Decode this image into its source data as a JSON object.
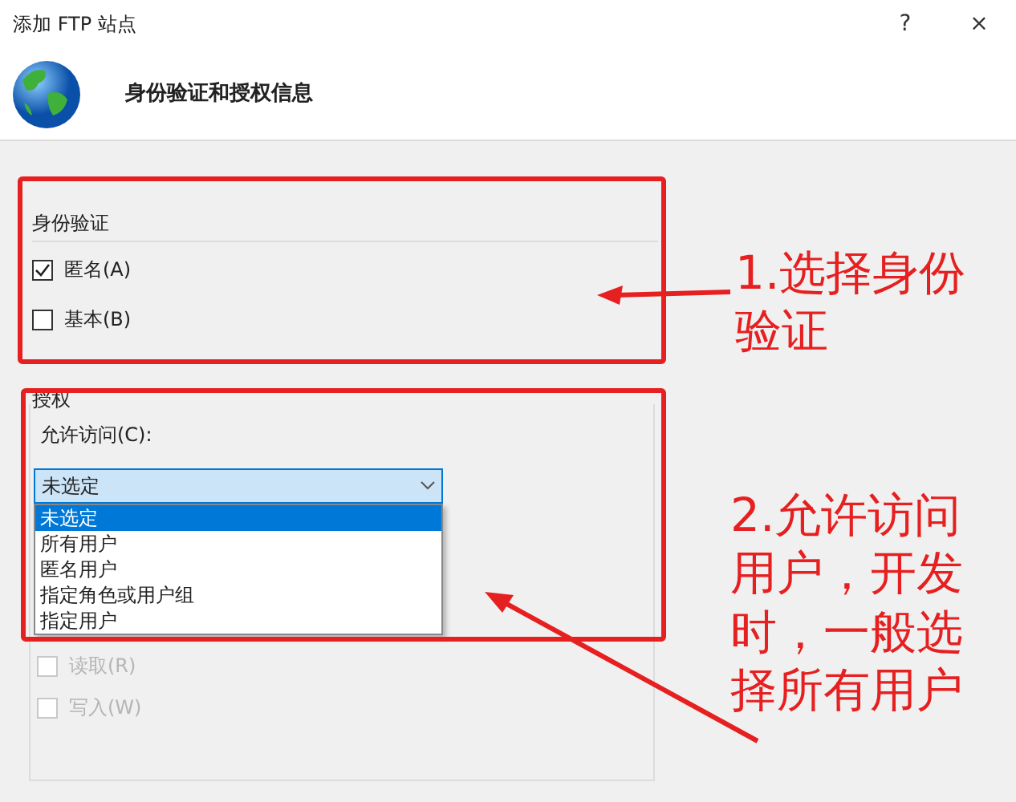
{
  "window": {
    "title": "添加 FTP 站点",
    "help": "?",
    "close": "×"
  },
  "header": {
    "title": "身份验证和授权信息"
  },
  "authentication": {
    "label": "身份验证",
    "options": [
      {
        "label": "匿名(A)",
        "checked": true
      },
      {
        "label": "基本(B)",
        "checked": false
      }
    ]
  },
  "authorization": {
    "label": "授权",
    "access_label": "允许访问(C):",
    "access_value": "未选定",
    "access_options": [
      {
        "label": "未选定",
        "selected": true
      },
      {
        "label": "所有用户",
        "selected": false
      },
      {
        "label": "匿名用户",
        "selected": false
      },
      {
        "label": "指定角色或用户组",
        "selected": false
      },
      {
        "label": "指定用户",
        "selected": false
      }
    ],
    "permissions": [
      {
        "label": "读取(R)",
        "checked": false,
        "disabled": true
      },
      {
        "label": "写入(W)",
        "checked": false,
        "disabled": true
      }
    ]
  },
  "annotations": [
    {
      "text": "1.选择身份验证"
    },
    {
      "text": "2.允许访问用户，开发时，一般选择所有用户"
    }
  ]
}
